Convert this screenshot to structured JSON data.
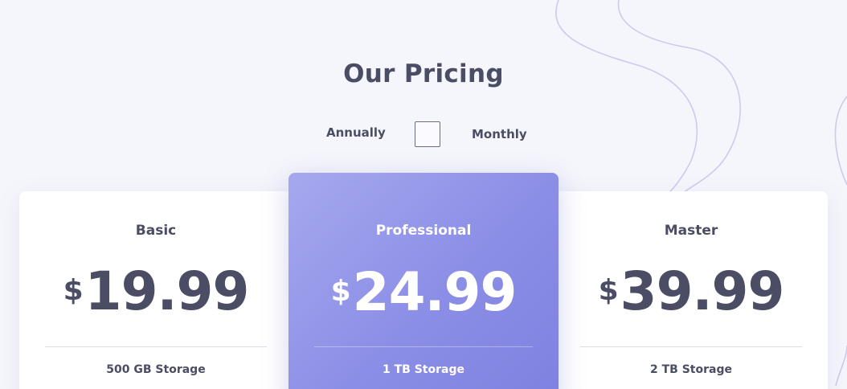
{
  "header": {
    "title": "Our Pricing"
  },
  "billing_toggle": {
    "left_label": "Annually",
    "right_label": "Monthly",
    "checked": false
  },
  "plans": [
    {
      "name": "Basic",
      "currency": "$",
      "price": "19.99",
      "features": [
        "500 GB Storage"
      ],
      "highlighted": false
    },
    {
      "name": "Professional",
      "currency": "$",
      "price": "24.99",
      "features": [
        "1 TB Storage"
      ],
      "highlighted": true
    },
    {
      "name": "Master",
      "currency": "$",
      "price": "39.99",
      "features": [
        "2 TB Storage"
      ],
      "highlighted": false
    }
  ],
  "colors": {
    "background": "#f5f5fc",
    "text": "#4a4d63",
    "accent_start": "#a6a8ee",
    "accent_end": "#7e81e0",
    "card": "#ffffff",
    "decoration_lines": "#c9cbf0"
  }
}
